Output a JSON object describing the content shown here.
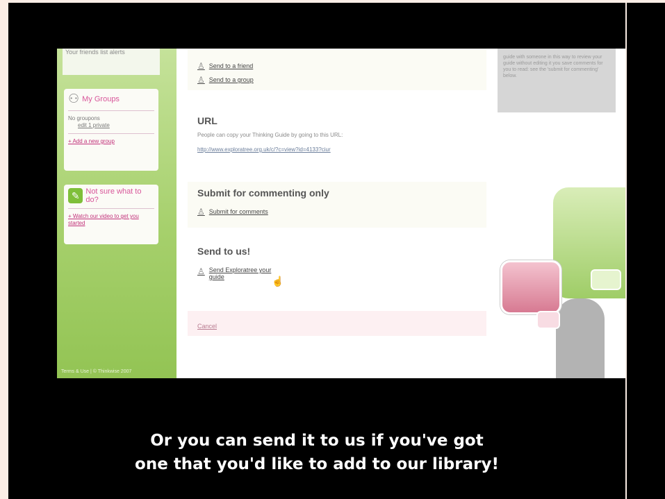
{
  "sidebar": {
    "top_text": "Your friends list alerts",
    "groups_title": "My Groups",
    "groups_text_1": "No groupons",
    "groups_text_2": "edit 1 private",
    "add_group": "+ Add a new group",
    "notsure_title": "Not sure what to do?",
    "notsure_link": "+ Watch our video to get you started",
    "footer": "Terms & Use | © Thinkwise 2007"
  },
  "share": {
    "friend": "Send to a friend",
    "group": "Send to a group"
  },
  "url_section": {
    "title": "URL",
    "desc": "People can copy your Thinking Guide by going to this URL:",
    "link": "http://www.exploratree.org.uk/c/?c=view?id=4133?ciur"
  },
  "comment_section": {
    "title": "Submit for commenting only",
    "link": "Submit for comments"
  },
  "sendus_section": {
    "title": "Send to us!",
    "link_line1": "Send Exploratree your",
    "link_line2": "guide"
  },
  "cancel": "Cancel",
  "tip_text": "guide with someone in this way to review your guide without editing it you save comments for you to read: see the 'submit for commenting' below.",
  "caption": {
    "line1": "Or you can send it to us if you've got",
    "line2": "one that you'd like to add to our library!"
  }
}
